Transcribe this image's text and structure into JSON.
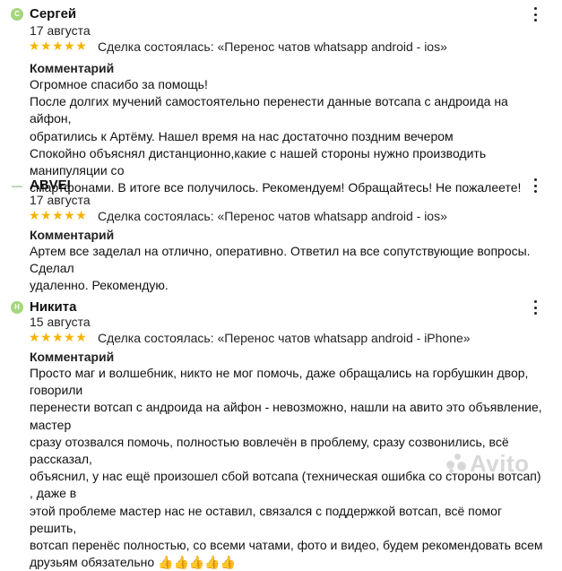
{
  "reviews": [
    {
      "avatar": "С",
      "name": "Сергей",
      "date": "17 августа",
      "stars": "★★★★★",
      "deal": "Сделка состоялась: «Перенос чатов whatsapp android - ios»",
      "comment_title": "Комментарий",
      "lines": [
        "Огромное спасибо за помощь!",
        "После долгих мучений самостоятельно перенести данные вотсапа с андроида на айфон,",
        "обратились к Артёму. Нашел время на нас достаточно поздним вечером",
        "Спокойно объяснял дистанционно,какие с нашей стороны нужно производить манипуляции со",
        "смартфонами. В итоге все получилось. Рекомендуем! Обращайтесь! Не пожалеете!"
      ]
    },
    {
      "avatar": "—",
      "name": "ABVEI",
      "date": "17 августа",
      "stars": "★★★★★",
      "deal": "Сделка состоялась: «Перенос чатов whatsapp android - ios»",
      "comment_title": "Комментарий",
      "lines": [
        "Артем все заделал на отлично, оперативно. Ответил на все сопутствующие вопросы. Сделал",
        "удаленно. Рекомендую."
      ]
    },
    {
      "avatar": "Н",
      "name": "Никита",
      "date": "15 августа",
      "stars": "★★★★★",
      "deal": "Сделка состоялась: «Перенос чатов whatsapp android - iPhone»",
      "comment_title": "Комментарий",
      "lines": [
        "Просто маг и волшебник, никто не мог помочь, даже обращались на горбушкин двор, говорили",
        "перенести вотсап с андроида на айфон - невозможно, нашли на авито это объявление, мастер",
        "сразу отозвался помочь, полностью вовлечён в проблему, сразу созвонились, всё рассказал,",
        "объяснил, у нас ещё произошел сбой вотсапа (техническая ошибка со стороны вотсап) , даже в",
        "этой проблеме мастер нас не оставил, связался с поддержкой вотсап, всё помог решить,",
        "вотсап перенёс полностью, со всеми чатами, фото и видео, будем рекомендовать всем",
        "друзьям обязательно 👍👍👍👍👍"
      ]
    }
  ],
  "watermark": "Avito"
}
